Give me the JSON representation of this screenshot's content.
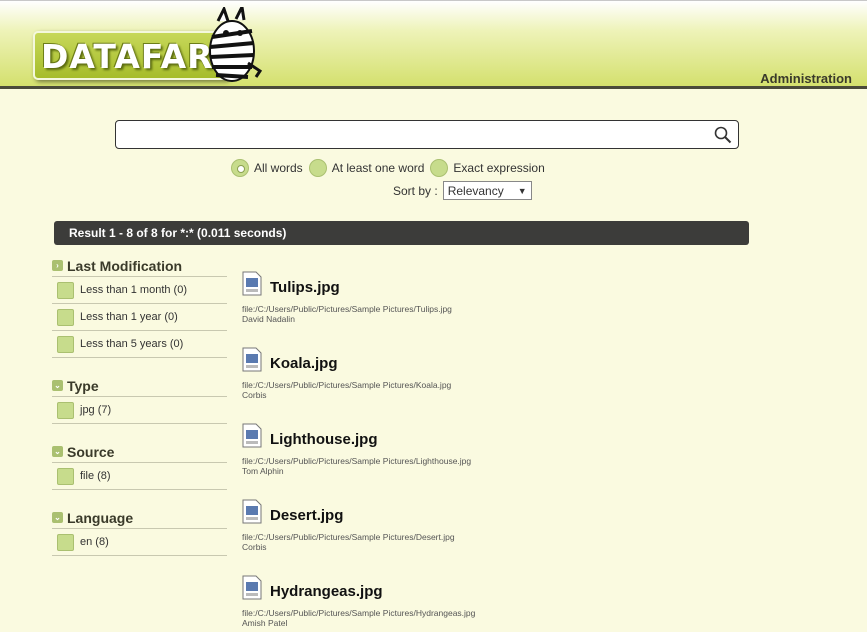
{
  "header": {
    "logo_text": "DATAFARI",
    "admin_label": "Administration"
  },
  "search": {
    "query": "",
    "placeholder": ""
  },
  "options": {
    "radios": [
      {
        "label": "All words",
        "checked": true
      },
      {
        "label": "At least one word",
        "checked": false
      },
      {
        "label": "Exact expression",
        "checked": false
      }
    ],
    "sort_label": "Sort by :",
    "sort_value": "Relevancy"
  },
  "result_summary": "Result 1 - 8 of 8 for *:* (0.011 seconds)",
  "facets": [
    {
      "title": "Last Modification",
      "items": [
        "Less than 1 month (0)",
        "Less than 1 year (0)",
        "Less than 5 years (0)"
      ]
    },
    {
      "title": "Type",
      "items": [
        "jpg (7)"
      ]
    },
    {
      "title": "Source",
      "items": [
        "file (8)"
      ]
    },
    {
      "title": "Language",
      "items": [
        "en (8)"
      ]
    }
  ],
  "results": [
    {
      "title": "Tulips.jpg",
      "url": "file:/C:/Users/Public/Pictures/Sample Pictures/Tulips.jpg",
      "author": "David Nadalin"
    },
    {
      "title": "Koala.jpg",
      "url": "file:/C:/Users/Public/Pictures/Sample Pictures/Koala.jpg",
      "author": "Corbis"
    },
    {
      "title": "Lighthouse.jpg",
      "url": "file:/C:/Users/Public/Pictures/Sample Pictures/Lighthouse.jpg",
      "author": "Tom Alphin"
    },
    {
      "title": "Desert.jpg",
      "url": "file:/C:/Users/Public/Pictures/Sample Pictures/Desert.jpg",
      "author": "Corbis"
    },
    {
      "title": "Hydrangeas.jpg",
      "url": "file:/C:/Users/Public/Pictures/Sample Pictures/Hydrangeas.jpg",
      "author": "Amish Patel"
    }
  ],
  "icons": {
    "search": "search-icon",
    "file": "jpeg-file-icon",
    "facet_marker": "collapse-icon",
    "logo_mascot": "zebra-logo-icon"
  },
  "colors": {
    "header_green": "#d4e06e",
    "page_bg": "#fafae0",
    "accent_green": "#c7dc8c",
    "result_bar": "#3c3c3a"
  }
}
